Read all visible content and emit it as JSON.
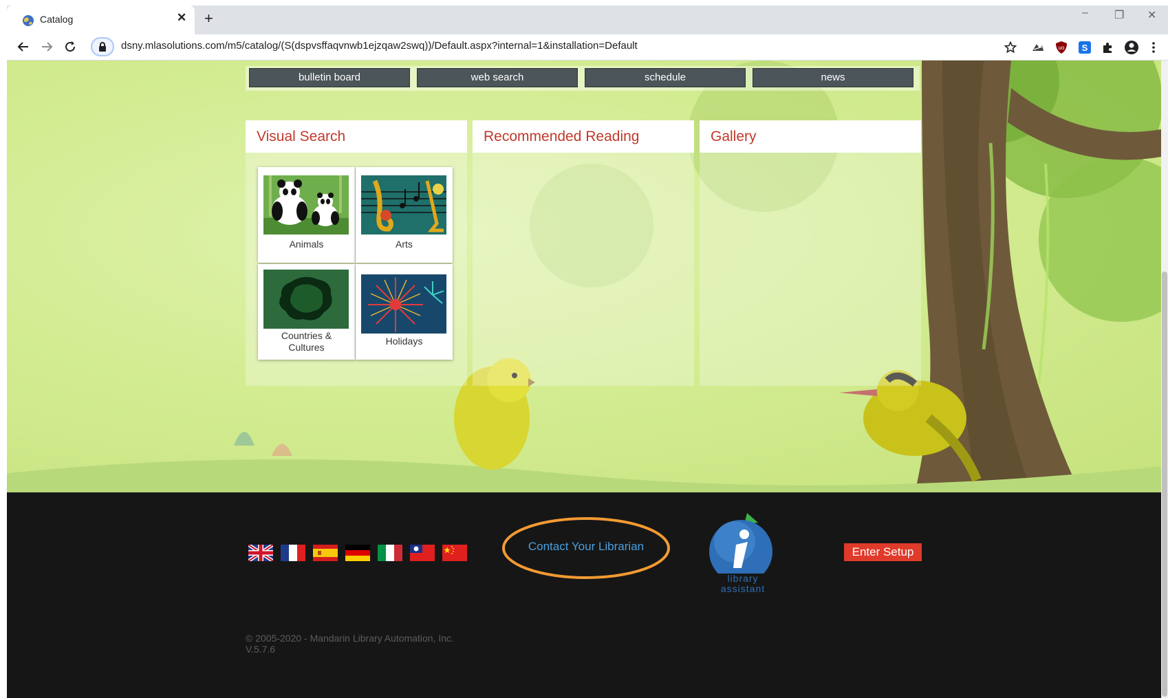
{
  "browser": {
    "tab_title": "Catalog",
    "tab_close": "✕",
    "new_tab": "+",
    "url": "dsny.mlasolutions.com/m5/catalog/(S(dspvsffaqvnwb1ejzqaw2swq))/Default.aspx?internal=1&installation=Default",
    "window_controls": {
      "minimize": "–",
      "restore": "❐",
      "close": "✕"
    },
    "extension_icons": [
      "bookmark-star-icon",
      "pasted-extension-icon",
      "ublock-icon",
      "s-extension-icon",
      "puzzle-extensions-icon",
      "profile-icon",
      "kebab-menu-icon"
    ]
  },
  "menu": {
    "items": [
      "bulletin board",
      "web search",
      "schedule",
      "news"
    ]
  },
  "panels": {
    "visual_search": {
      "title": "Visual Search",
      "tiles": [
        "Animals",
        "Arts",
        "Countries &\nCultures",
        "Holidays"
      ]
    },
    "recommended_reading": {
      "title": "Recommended Reading"
    },
    "gallery": {
      "title": "Gallery"
    }
  },
  "footer": {
    "flags": [
      "english-flag",
      "french-flag",
      "spanish-flag",
      "german-flag",
      "italian-flag",
      "taiwan-flag",
      "chinese-flag"
    ],
    "contact_link": "Contact Your Librarian",
    "assistant_line1": "library",
    "assistant_line2": "assistant",
    "setup_button": "Enter Setup",
    "copyright": "© 2005-2020 - Mandarin Library Automation, Inc.",
    "version": "V.5.7.6"
  },
  "colors": {
    "panel_title": "#c0392b",
    "menu_button": "#4c5559",
    "footer_bg": "#161616",
    "link_blue": "#4a9fe0",
    "setup_red": "#e03a2a",
    "highlight_ring": "#f39a33"
  }
}
